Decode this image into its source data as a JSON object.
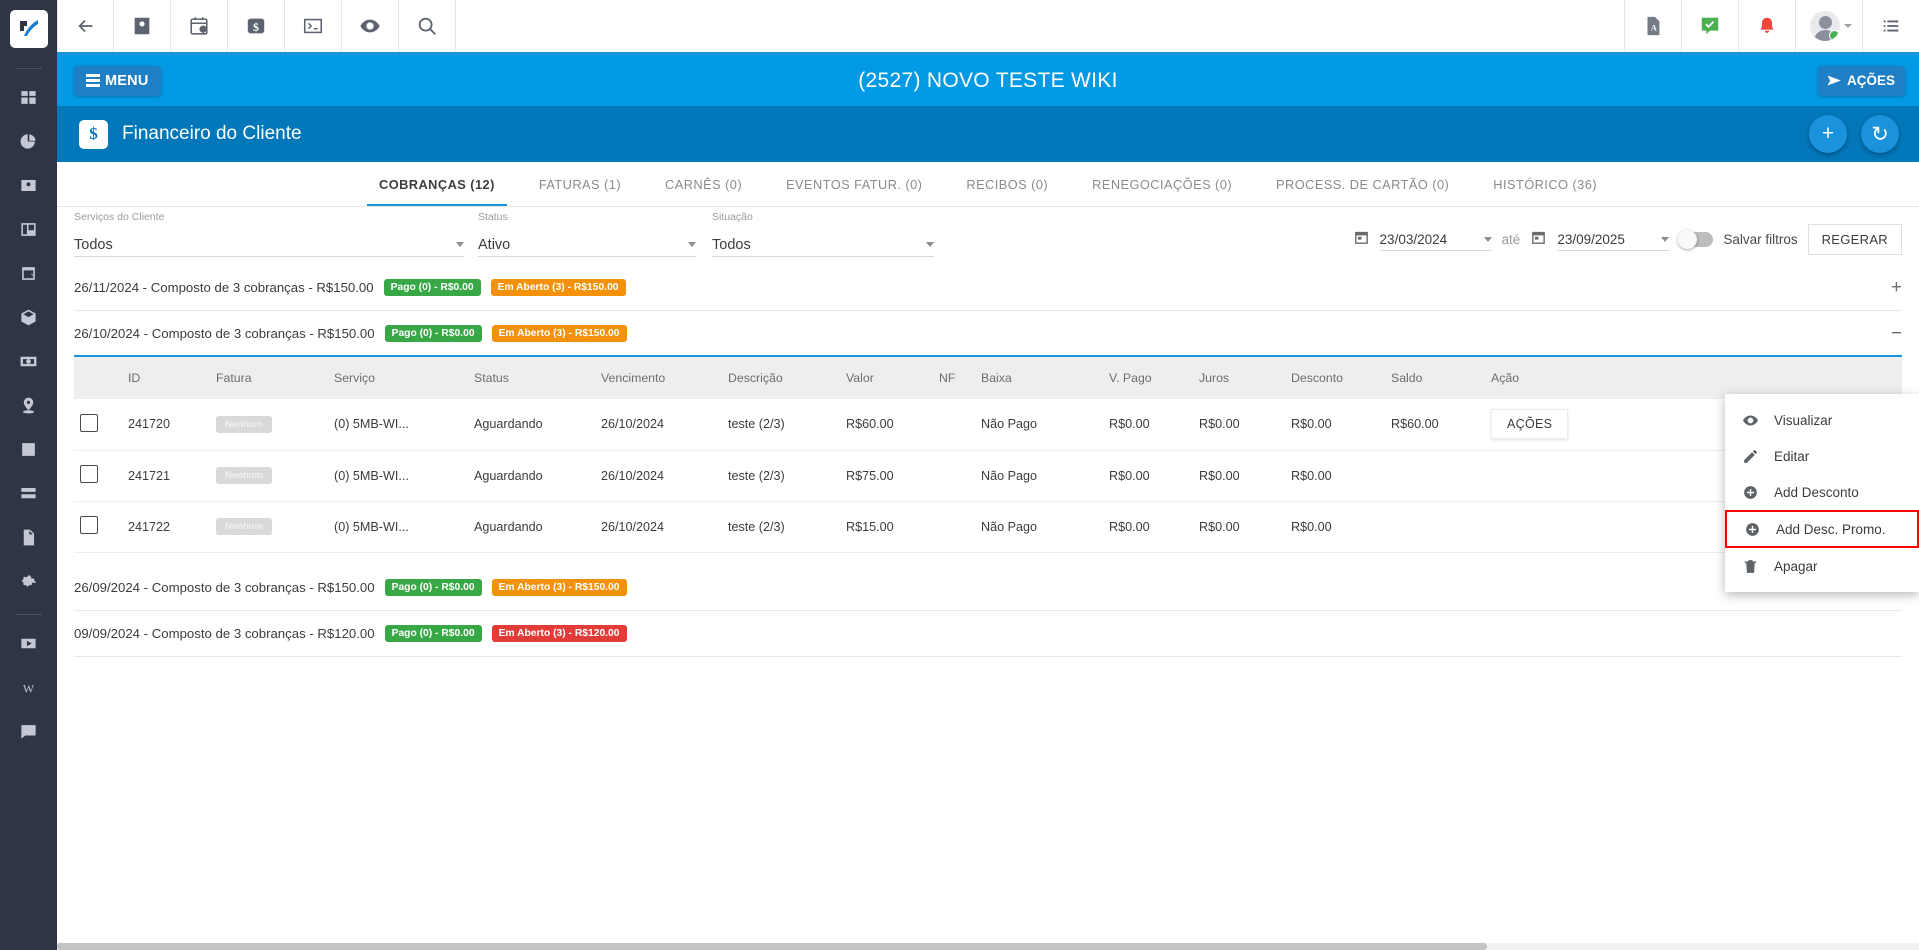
{
  "rail": {
    "logo_alt": "app-logo",
    "items": [
      {
        "name": "dashboard-icon"
      },
      {
        "name": "chart-pie-icon"
      },
      {
        "name": "contact-card-icon"
      },
      {
        "name": "kanban-icon"
      },
      {
        "name": "calendar-clock-icon"
      },
      {
        "name": "box-icon"
      },
      {
        "name": "money-bill-icon"
      },
      {
        "name": "map-pin-icon"
      },
      {
        "name": "list-icon"
      },
      {
        "name": "server-icon"
      },
      {
        "name": "document-icon"
      },
      {
        "name": "gear-icon"
      },
      {
        "name": "video-icon"
      },
      {
        "name": "wiki-icon"
      },
      {
        "name": "chat-icon"
      }
    ]
  },
  "topbar": {
    "left_icons": [
      {
        "name": "back-arrow-icon"
      },
      {
        "name": "contact-icon"
      },
      {
        "name": "calendar-clock-icon"
      },
      {
        "name": "money-icon"
      },
      {
        "name": "terminal-icon"
      },
      {
        "name": "eye-icon"
      },
      {
        "name": "search-icon"
      }
    ],
    "right_icons": [
      {
        "name": "pdf-icon"
      },
      {
        "name": "task-check-icon"
      },
      {
        "name": "bell-icon"
      }
    ],
    "menu_icon": "list-menu-icon"
  },
  "bluebar": {
    "menu_label": "MENU",
    "title": "(2527) NOVO TESTE WIKI",
    "acoes_label": "AÇÕES"
  },
  "page_header": {
    "icon": "dollar-icon",
    "icon_glyph": "$",
    "title": "Financeiro do Cliente",
    "add_button": "+",
    "refresh_button": "↻"
  },
  "tabs": [
    {
      "label": "COBRANÇAS (12)",
      "active": true
    },
    {
      "label": "FATURAS (1)",
      "active": false
    },
    {
      "label": "CARNÊS (0)",
      "active": false
    },
    {
      "label": "EVENTOS FATUR. (0)",
      "active": false
    },
    {
      "label": "RECIBOS (0)",
      "active": false
    },
    {
      "label": "RENEGOCIAÇÕES (0)",
      "active": false
    },
    {
      "label": "PROCESS. DE CARTÃO (0)",
      "active": false
    },
    {
      "label": "HISTÓRICO (36)",
      "active": false
    }
  ],
  "filters": {
    "servicos_label": "Serviços do Cliente",
    "servicos_value": "Todos",
    "status_label": "Status",
    "status_value": "Ativo",
    "situacao_label": "Situação",
    "situacao_value": "Todos",
    "date_from": "23/03/2024",
    "date_sep": "até",
    "date_to": "23/09/2025",
    "save_filters_label": "Salvar filtros",
    "regerar_label": "REGERAR"
  },
  "groups": [
    {
      "title": "26/11/2024 - Composto de 3 cobranças - R$150.00",
      "paid_badge": "Pago (0) - R$0.00",
      "open_badge": "Em Aberto (3) - R$150.00",
      "open_badge_color": "orange",
      "expander": "+",
      "expanded": false
    },
    {
      "title": "26/10/2024 - Composto de 3 cobranças - R$150.00",
      "paid_badge": "Pago (0) - R$0.00",
      "open_badge": "Em Aberto (3) - R$150.00",
      "open_badge_color": "orange",
      "expander": "−",
      "expanded": true
    },
    {
      "title": "26/09/2024 - Composto de 3 cobranças - R$150.00",
      "paid_badge": "Pago (0) - R$0.00",
      "open_badge": "Em Aberto (3) - R$150.00",
      "open_badge_color": "orange",
      "expander": "",
      "expanded": false
    },
    {
      "title": "09/09/2024 - Composto de 3 cobranças - R$120.00",
      "paid_badge": "Pago (0) - R$0.00",
      "open_badge": "Em Aberto (3) - R$120.00",
      "open_badge_color": "red",
      "expander": "",
      "expanded": false
    }
  ],
  "table": {
    "columns": [
      "",
      "ID",
      "Fatura",
      "Serviço",
      "Status",
      "Vencimento",
      "Descrição",
      "Valor",
      "NF",
      "Baixa",
      "V. Pago",
      "Juros",
      "Desconto",
      "Saldo",
      "Ação"
    ],
    "rows": [
      {
        "id": "241720",
        "fatura": "Nenhum",
        "servico": "(0) 5MB-WI...",
        "status": "Aguardando",
        "vencimento": "26/10/2024",
        "descricao": "teste (2/3)",
        "valor": "R$60.00",
        "nf": "",
        "baixa": "Não Pago",
        "vpago": "R$0.00",
        "juros": "R$0.00",
        "desconto": "R$0.00",
        "saldo": "R$60.00",
        "acao": "AÇÕES"
      },
      {
        "id": "241721",
        "fatura": "Nenhum",
        "servico": "(0) 5MB-WI...",
        "status": "Aguardando",
        "vencimento": "26/10/2024",
        "descricao": "teste (2/3)",
        "valor": "R$75.00",
        "nf": "",
        "baixa": "Não Pago",
        "vpago": "R$0.00",
        "juros": "R$0.00",
        "desconto": "R$0.00",
        "saldo": "",
        "acao": ""
      },
      {
        "id": "241722",
        "fatura": "Nenhum",
        "servico": "(0) 5MB-WI...",
        "status": "Aguardando",
        "vencimento": "26/10/2024",
        "descricao": "teste (2/3)",
        "valor": "R$15.00",
        "nf": "",
        "baixa": "Não Pago",
        "vpago": "R$0.00",
        "juros": "R$0.00",
        "desconto": "R$0.00",
        "saldo": "",
        "acao": ""
      }
    ]
  },
  "context_menu": {
    "items": [
      {
        "label": "Visualizar",
        "icon": "eye-icon",
        "highlighted": false
      },
      {
        "label": "Editar",
        "icon": "pencil-icon",
        "highlighted": false
      },
      {
        "label": "Add Desconto",
        "icon": "plus-circle-icon",
        "highlighted": false
      },
      {
        "label": "Add Desc. Promo.",
        "icon": "plus-circle-icon",
        "highlighted": true
      },
      {
        "label": "Apagar",
        "icon": "trash-icon",
        "highlighted": false
      }
    ],
    "highlight_color": "#ff0000"
  },
  "colors": {
    "accent_blue": "#039ae5",
    "header_blue": "#0277ba",
    "rail_dark": "#2f3545",
    "green": "#38a846",
    "orange": "#f39108",
    "red": "#e23b38",
    "status_amber": "#f5a321"
  }
}
